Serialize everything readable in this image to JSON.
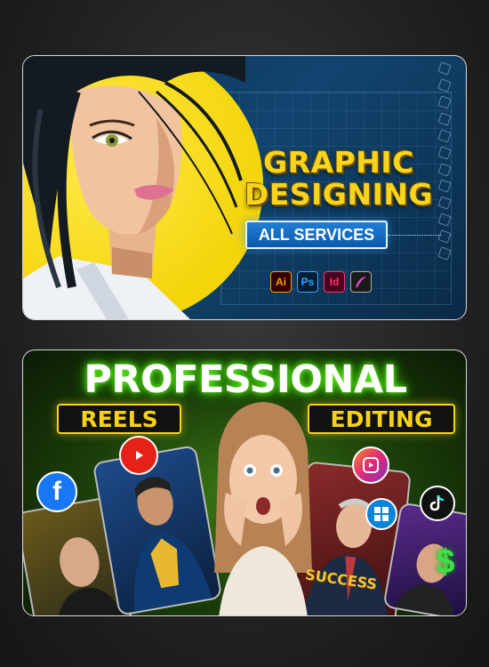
{
  "card1": {
    "title_line1": "GRAPHIC",
    "title_line2": "DESIGNING",
    "button": "ALL SERVICES",
    "apps": [
      {
        "label": "Ai",
        "icon": "illustrator-icon"
      },
      {
        "label": "Ps",
        "icon": "photoshop-icon"
      },
      {
        "label": "Id",
        "icon": "indesign-icon"
      },
      {
        "label": "",
        "icon": "procreate-icon"
      }
    ]
  },
  "card2": {
    "title": "PROFESSIONAL",
    "tag_left": "REELS",
    "tag_right": "EDITING",
    "success": "SUCCESS",
    "icons": [
      "facebook-icon",
      "youtube-shorts-icon",
      "instagram-reels-icon",
      "windows-icon",
      "tiktok-icon",
      "dollar-icon"
    ]
  },
  "colors": {
    "accent_yellow": "#f6d21a",
    "blue_button": "#0d59a8",
    "green_glow": "#66ff22"
  }
}
